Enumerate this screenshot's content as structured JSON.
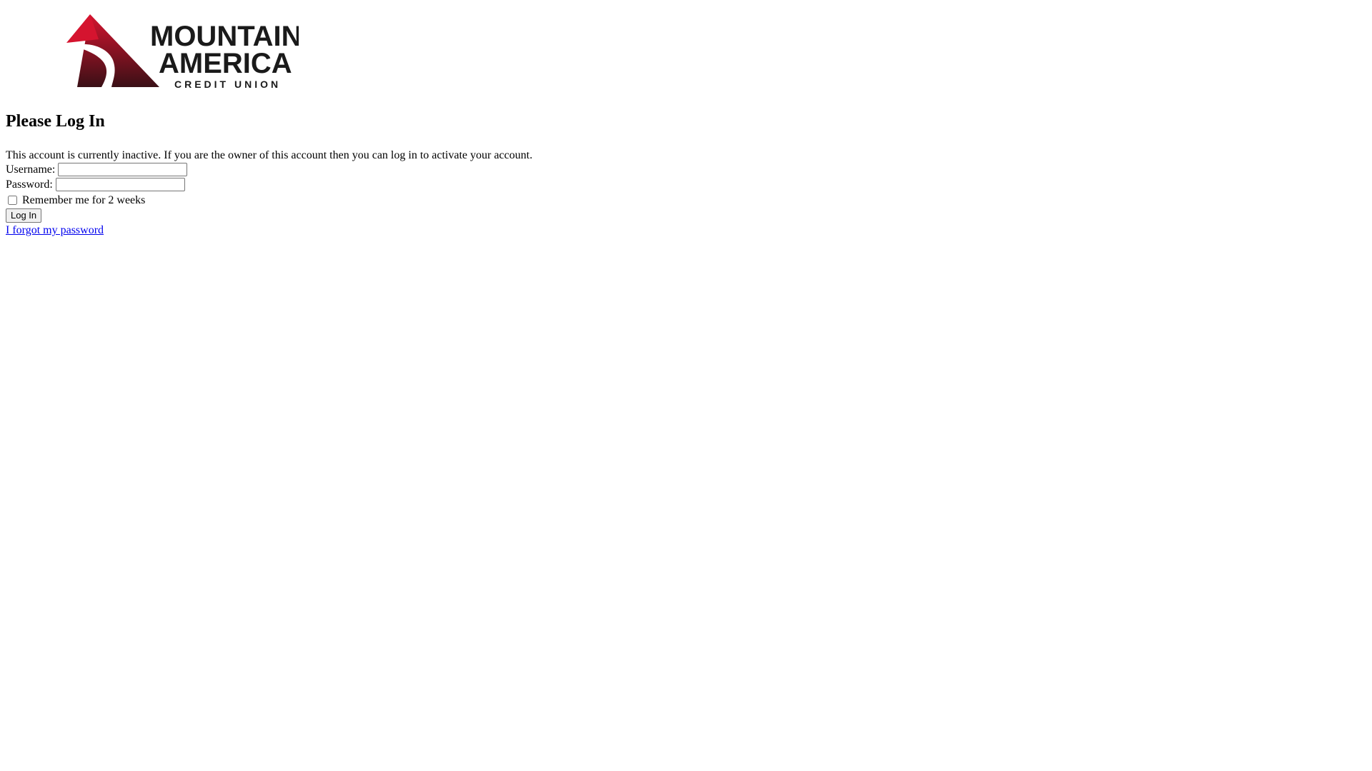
{
  "brand": {
    "logo_line1": "MOUNTAIN",
    "logo_line2": "AMERICA",
    "logo_line3": "CREDIT UNION",
    "logo_red": "#c8102e",
    "logo_dark": "#1a1a1a"
  },
  "main": {
    "title": "Please Log In",
    "message": "This account is currently inactive. If you are the owner of this account then you can log in to activate your account."
  },
  "form": {
    "username_label": "Username:",
    "username_value": "",
    "password_label": "Password:",
    "password_value": "",
    "remember_label": "Remember me for 2 weeks",
    "remember_checked": false,
    "submit_label": "Log In",
    "forgot_link": "I forgot my password"
  }
}
